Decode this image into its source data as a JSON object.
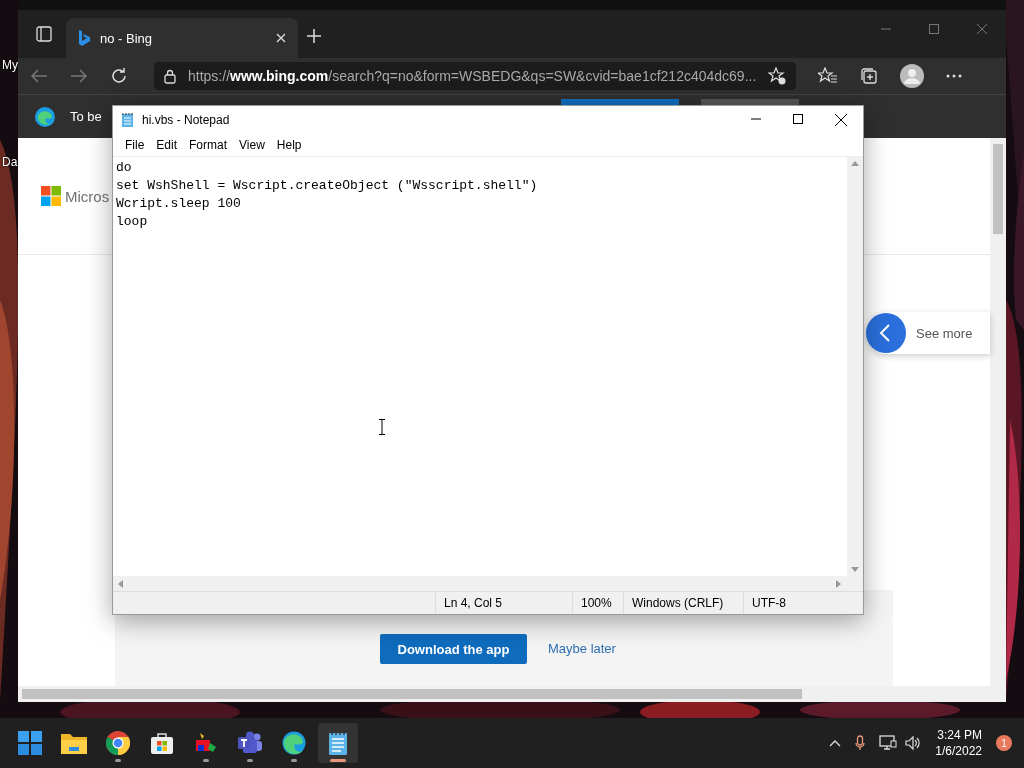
{
  "desktop": {
    "icon_labels": [
      "My",
      "Da"
    ]
  },
  "browser": {
    "tabs": [
      {
        "label": "no - Bing",
        "selected": true
      }
    ],
    "url": "https://**www.bing.com**/search?q=no&form=WSBEDG&qs=SW&cvid=bae1cf212c404dc69...",
    "infobar_text": "To be",
    "page": {
      "logo_text": "Micros",
      "see_more": "See more",
      "primary_button": "Download the app",
      "link": "Maybe later"
    }
  },
  "notepad": {
    "title": "hi.vbs - Notepad",
    "menu": [
      "File",
      "Edit",
      "Format",
      "View",
      "Help"
    ],
    "lines": [
      "do",
      "set WshShell = Wscript.createObject (\"Wsscript.shell\")",
      "Wcript.sleep 100",
      "loop"
    ],
    "status": [
      "Ln 4, Col 5",
      "100%",
      "Windows (CRLF)",
      "UTF-8"
    ]
  },
  "taskbar": {
    "apps": [
      {
        "kind": "start",
        "running": false,
        "active": false
      },
      {
        "kind": "folder",
        "running": false,
        "active": false
      },
      {
        "kind": "chrome",
        "running": true,
        "active": false
      },
      {
        "kind": "store",
        "running": false,
        "active": false
      },
      {
        "kind": "paint",
        "running": true,
        "active": false
      },
      {
        "kind": "teams",
        "running": true,
        "active": false
      },
      {
        "kind": "edge",
        "running": true,
        "active": false
      },
      {
        "kind": "notepad",
        "running": true,
        "active": true
      }
    ],
    "time": "3:24 PM",
    "date": "1/6/2022",
    "notifications": "1"
  }
}
